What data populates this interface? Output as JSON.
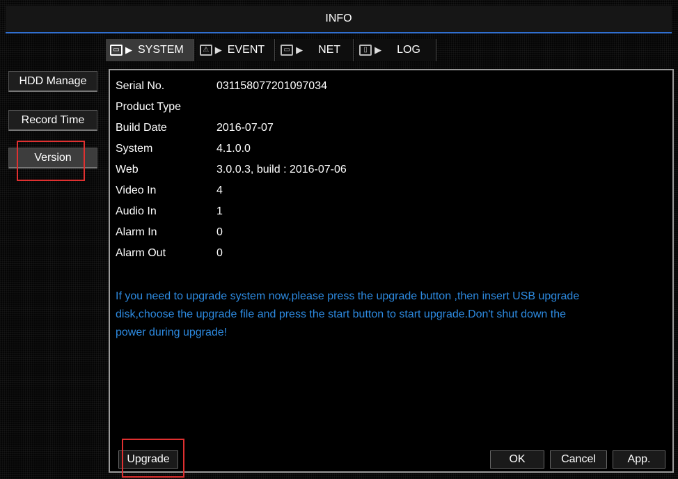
{
  "window": {
    "title": "INFO"
  },
  "tabs": [
    {
      "label": "SYSTEM",
      "icon": "monitor-icon",
      "active": true
    },
    {
      "label": "EVENT",
      "icon": "warning-icon",
      "active": false
    },
    {
      "label": "NET",
      "icon": "network-icon",
      "active": false
    },
    {
      "label": "LOG",
      "icon": "log-icon",
      "active": false
    }
  ],
  "sidebar": {
    "items": [
      {
        "label": "HDD Manage",
        "active": false
      },
      {
        "label": "Record Time",
        "active": false
      },
      {
        "label": "Version",
        "active": true
      }
    ]
  },
  "info": {
    "rows": [
      {
        "label": "Serial No.",
        "value": "031158077201097034"
      },
      {
        "label": "Product Type",
        "value": ""
      },
      {
        "label": "Build Date",
        "value": "2016-07-07"
      },
      {
        "label": "System",
        "value": "4.1.0.0"
      },
      {
        "label": "Web",
        "value": "3.0.0.3, build : 2016-07-06"
      },
      {
        "label": "Video In",
        "value": "4"
      },
      {
        "label": "Audio In",
        "value": "1"
      },
      {
        "label": "Alarm In",
        "value": "0"
      },
      {
        "label": "Alarm Out",
        "value": "0"
      }
    ],
    "note": "If you need to upgrade system now,please press the upgrade button ,then insert USB upgrade disk,choose the upgrade file and press the start button to start upgrade.Don't shut down the power during upgrade!"
  },
  "buttons": {
    "upgrade": "Upgrade",
    "ok": "OK",
    "cancel": "Cancel",
    "apply": "App."
  },
  "colors": {
    "accent": "#2f6fd1",
    "note_text": "#2d8ae0",
    "highlight": "#e03030"
  }
}
